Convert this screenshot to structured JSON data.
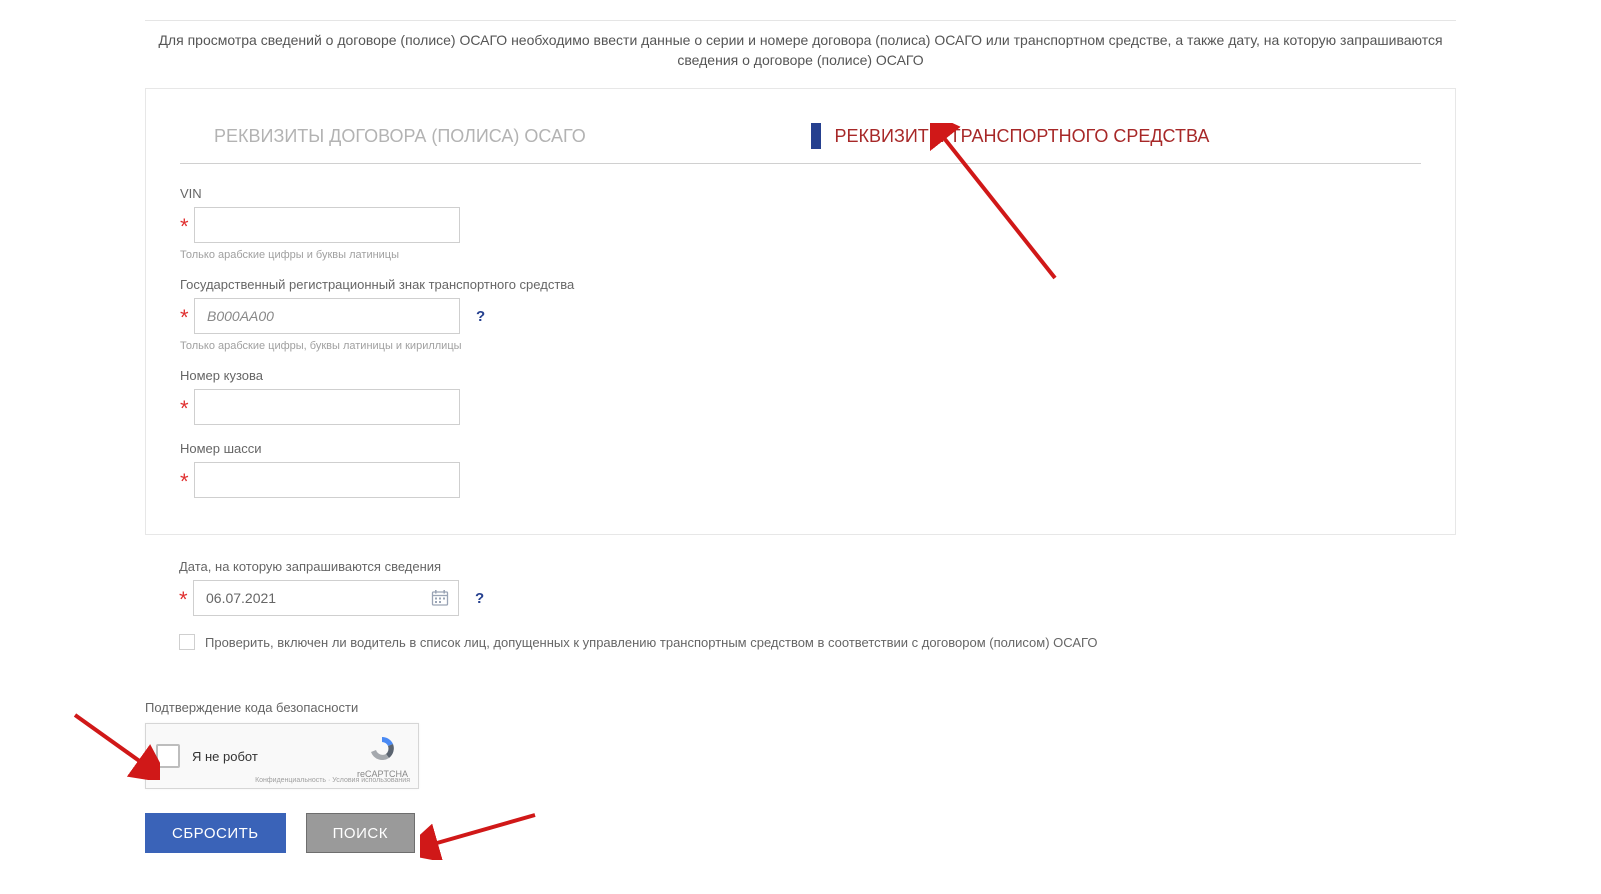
{
  "intro": "Для просмотра сведений о договоре (полисе) ОСАГО необходимо ввести данные о серии и номере договора (полиса) ОСАГО или транспортном средстве, а также дату, на которую запрашиваются сведения о договоре (полисе) ОСАГО",
  "tabs": {
    "policy": "РЕКВИЗИТЫ ДОГОВОРА (ПОЛИСА) ОСАГО",
    "vehicle": "РЕКВИЗИТЫ ТРАНСПОРТНОГО СРЕДСТВА"
  },
  "fields": {
    "vin": {
      "label": "VIN",
      "value": "",
      "hint": "Только арабские цифры и буквы латиницы"
    },
    "grz": {
      "label": "Государственный регистрационный знак транспортного средства",
      "placeholder": "В000АА00",
      "hint": "Только арабские цифры, буквы латиницы и кириллицы",
      "help": "?"
    },
    "body": {
      "label": "Номер кузова",
      "value": ""
    },
    "chassis": {
      "label": "Номер шасси",
      "value": ""
    },
    "date": {
      "label": "Дата, на которую запрашиваются сведения",
      "value": "06.07.2021",
      "help": "?"
    }
  },
  "driverCheck": "Проверить, включен ли водитель в список лиц, допущенных к управлению транспортным средством в соответствии с договором (полисом) ОСАГО",
  "captcha": {
    "title": "Подтверждение кода безопасности",
    "label": "Я не робот",
    "brand": "reCAPTCHA",
    "legal": "Конфиденциальность · Условия использования"
  },
  "buttons": {
    "reset": "СБРОСИТЬ",
    "search": "ПОИСК"
  },
  "asterisk": "*"
}
